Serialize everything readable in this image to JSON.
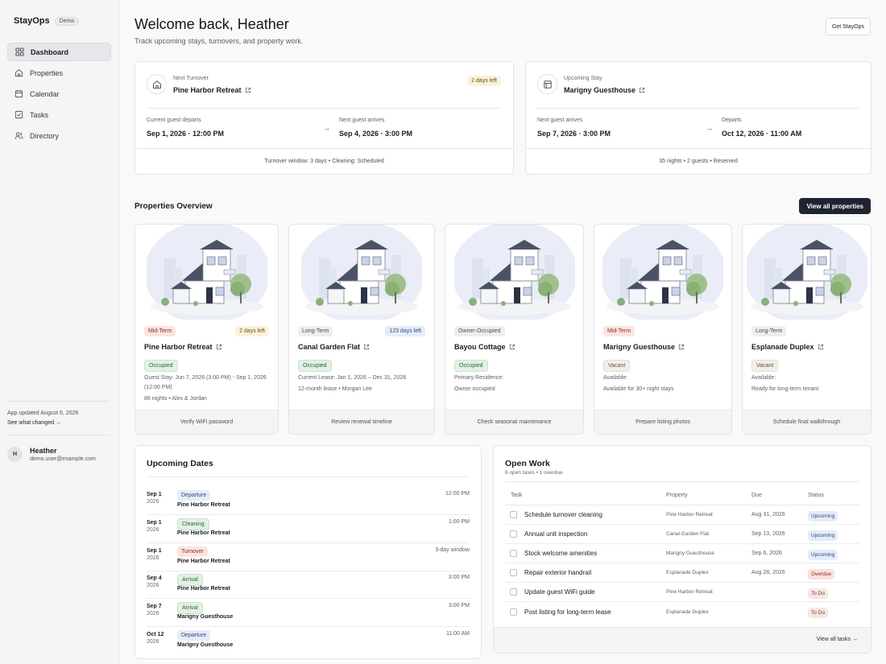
{
  "sidebar": {
    "brand": "StayOps",
    "badge": "Demo",
    "nav": [
      {
        "label": "Dashboard",
        "icon": "grid-icon"
      },
      {
        "label": "Properties",
        "icon": "home-icon"
      },
      {
        "label": "Calendar",
        "icon": "calendar-icon"
      },
      {
        "label": "Tasks",
        "icon": "checkbox-icon"
      },
      {
        "label": "Directory",
        "icon": "users-icon"
      }
    ],
    "update_text": "App updated August 6, 2026",
    "update_link": "See what changed →",
    "user": {
      "initial": "H",
      "name": "Heather",
      "email": "demo.user@example.com"
    }
  },
  "header": {
    "title": "Welcome back, Heather",
    "subtitle": "Track upcoming stays, turnovers, and property work.",
    "cta": "Get StayOps"
  },
  "turnover": {
    "label": "Next Turnover",
    "property": "Pine Harbor Retreat",
    "badge": "2 days left",
    "left_label": "Current guest departs",
    "left_value": "Sep 1, 2026 · 12:00 PM",
    "right_label": "Next guest arrives",
    "right_value": "Sep 4, 2026 · 3:00 PM",
    "footer": "Turnover window: 3 days • Cleaning: Scheduled"
  },
  "stay": {
    "label": "Upcoming Stay",
    "property": "Marigny Guesthouse",
    "left_label": "Next guest arrives",
    "left_value": "Sep 7, 2026 · 3:00 PM",
    "right_label": "Departs",
    "right_value": "Oct 12, 2026 · 11:00 AM",
    "footer": "35 nights • 2 guests • Reserved"
  },
  "overview": {
    "title": "Properties Overview",
    "button": "View all properties",
    "cards": [
      {
        "type": "Mid-Term",
        "badge": "2 days left",
        "name": "Pine Harbor Retreat",
        "status": "Occupied",
        "info1": "Guest Stay: Jun 7, 2026 (3:00 PM) - Sep 1, 2026 (12:00 PM)",
        "info2": "86 nights • Alex & Jordan",
        "action": "Verify WiFi password"
      },
      {
        "type": "Long-Term",
        "badge": "123 days left",
        "name": "Canal Garden Flat",
        "status": "Occupied",
        "info1": "Current Lease: Jan 1, 2026 – Dec 31, 2026",
        "info2": "12-month lease • Morgan Lee",
        "action": "Review renewal timeline"
      },
      {
        "type": "Owner-Occupied",
        "badge": "",
        "name": "Bayou Cottage",
        "status": "Occupied",
        "info1": "Primary Residence:",
        "info2": "Owner occupied",
        "action": "Check seasonal maintenance"
      },
      {
        "type": "Mid-Term",
        "badge": "",
        "name": "Marigny Guesthouse",
        "status": "Vacant",
        "info1": "Available:",
        "info2": "Available for 30+ night stays",
        "action": "Prepare listing photos"
      },
      {
        "type": "Long-Term",
        "badge": "",
        "name": "Esplanade Duplex",
        "status": "Vacant",
        "info1": "Available:",
        "info2": "Ready for long-term tenant",
        "action": "Schedule final walkthrough"
      }
    ]
  },
  "upcoming": {
    "title": "Upcoming Dates",
    "rows": [
      {
        "date": "Sep 1",
        "year": "2026",
        "event": "Departure",
        "property": "Pine Harbor Retreat",
        "time": "12:00 PM",
        "kind": "blue"
      },
      {
        "date": "Sep 1",
        "year": "2026",
        "event": "Cleaning",
        "property": "Pine Harbor Retreat",
        "time": "1:00 PM",
        "kind": "green"
      },
      {
        "date": "Sep 1",
        "year": "2026",
        "event": "Turnover",
        "property": "Pine Harbor Retreat",
        "time": "3-day window",
        "kind": "red"
      },
      {
        "date": "Sep 4",
        "year": "2026",
        "event": "Arrival",
        "property": "Pine Harbor Retreat",
        "time": "3:00 PM",
        "kind": "green"
      },
      {
        "date": "Sep 7",
        "year": "2026",
        "event": "Arrival",
        "property": "Marigny Guesthouse",
        "time": "3:00 PM",
        "kind": "green"
      },
      {
        "date": "Oct 12",
        "year": "2026",
        "event": "Departure",
        "property": "Marigny Guesthouse",
        "time": "11:00 AM",
        "kind": "blue"
      }
    ]
  },
  "work": {
    "title": "Open Work",
    "summary": "6 open tasks • 1 overdue",
    "headers": [
      "Task",
      "Property",
      "Due",
      "Status"
    ],
    "rows": [
      {
        "task": "Schedule turnover cleaning",
        "property": "Pine Harbor Retreat",
        "due": "Aug 31, 2026",
        "status": "Upcoming",
        "kind": "blue"
      },
      {
        "task": "Annual unit inspection",
        "property": "Canal Garden Flat",
        "due": "Sep 13, 2026",
        "status": "Upcoming",
        "kind": "blue"
      },
      {
        "task": "Stock welcome amenities",
        "property": "Marigny Guesthouse",
        "due": "Sep 6, 2026",
        "status": "Upcoming",
        "kind": "blue"
      },
      {
        "task": "Repair exterior handrail",
        "property": "Esplanade Duplex",
        "due": "Aug 28, 2026",
        "status": "Overdue",
        "kind": "red2"
      },
      {
        "task": "Update guest WiFi guide",
        "property": "Pine Harbor Retreat",
        "due": "",
        "status": "To Do",
        "kind": "todo"
      },
      {
        "task": "Post listing for long-term lease",
        "property": "Esplanade Duplex",
        "due": "",
        "status": "To Do",
        "kind": "todo"
      }
    ],
    "footer_link": "View all tasks →"
  }
}
